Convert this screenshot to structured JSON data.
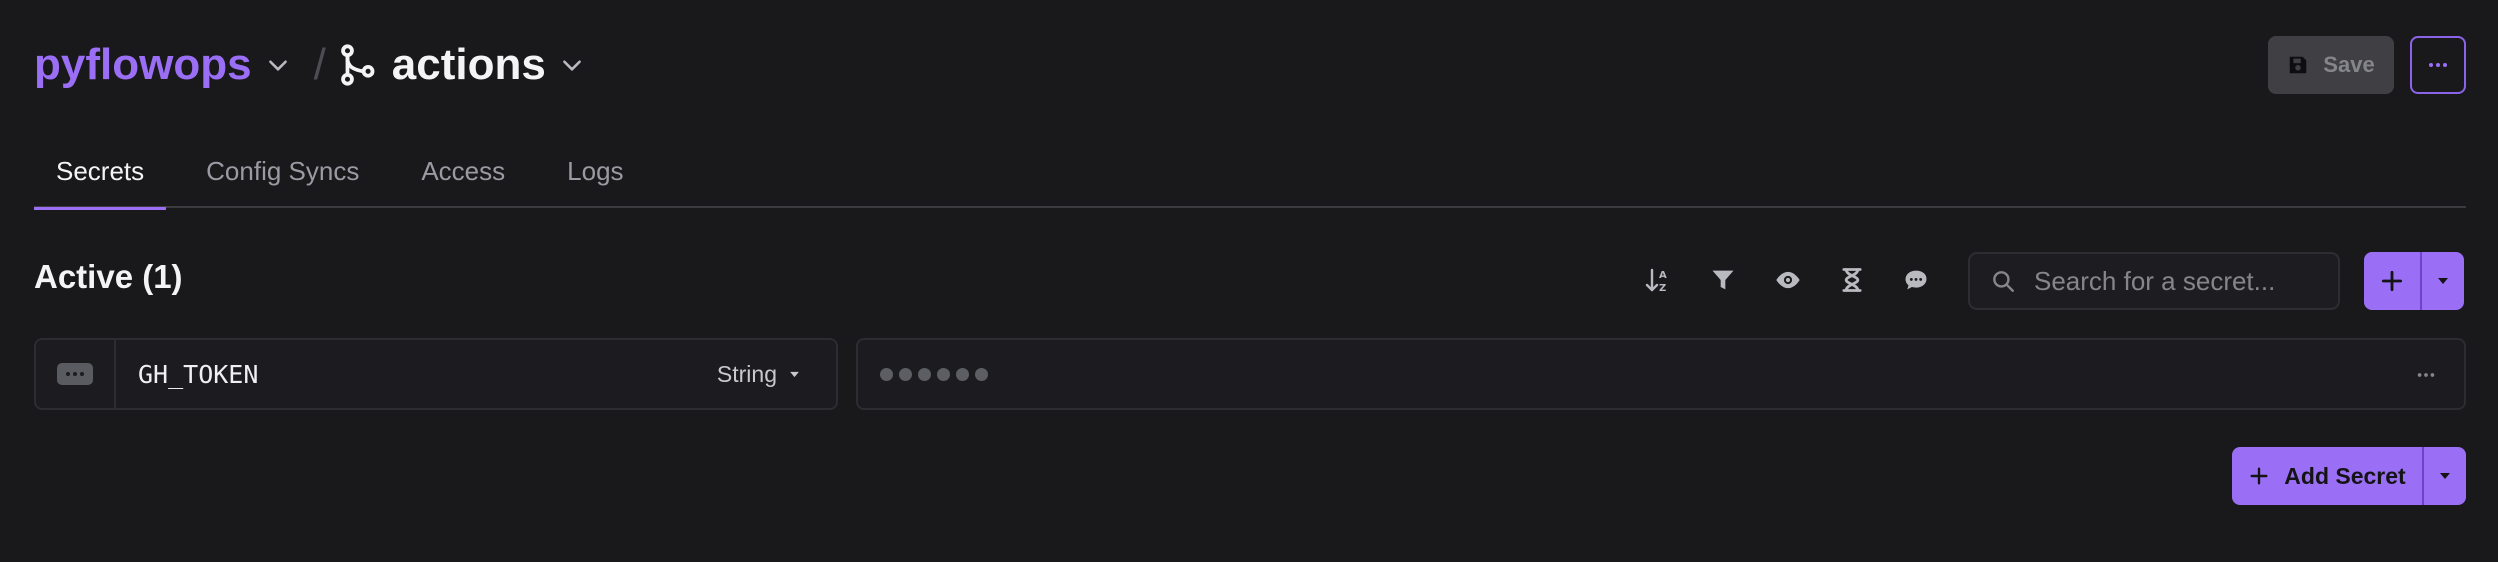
{
  "breadcrumb": {
    "workspace": "pyflowops",
    "separator": "/",
    "project": "actions"
  },
  "toolbar": {
    "save_label": "Save"
  },
  "tabs": [
    {
      "label": "Secrets",
      "active": true
    },
    {
      "label": "Config Syncs",
      "active": false
    },
    {
      "label": "Access",
      "active": false
    },
    {
      "label": "Logs",
      "active": false
    }
  ],
  "secrets": {
    "title": "Active (1)",
    "search_placeholder": "Search for a secret...",
    "rows": [
      {
        "name": "GH_TOKEN",
        "type": "String",
        "masked": true
      }
    ],
    "add_label": "Add Secret"
  },
  "icons": {
    "workspace_caret": "chevron-down-icon",
    "branch": "git-branch-icon",
    "save": "floppy-disk-icon",
    "more": "ellipsis-icon",
    "sort": "sort-alpha-icon",
    "filter": "filter-icon",
    "visibility": "eye-icon",
    "expiry": "hourglass-icon",
    "comments": "comment-icon",
    "search": "search-icon",
    "add": "plus-icon"
  },
  "colors": {
    "accent": "#9b6ff5",
    "background": "#19191c",
    "text": "#ededef"
  }
}
